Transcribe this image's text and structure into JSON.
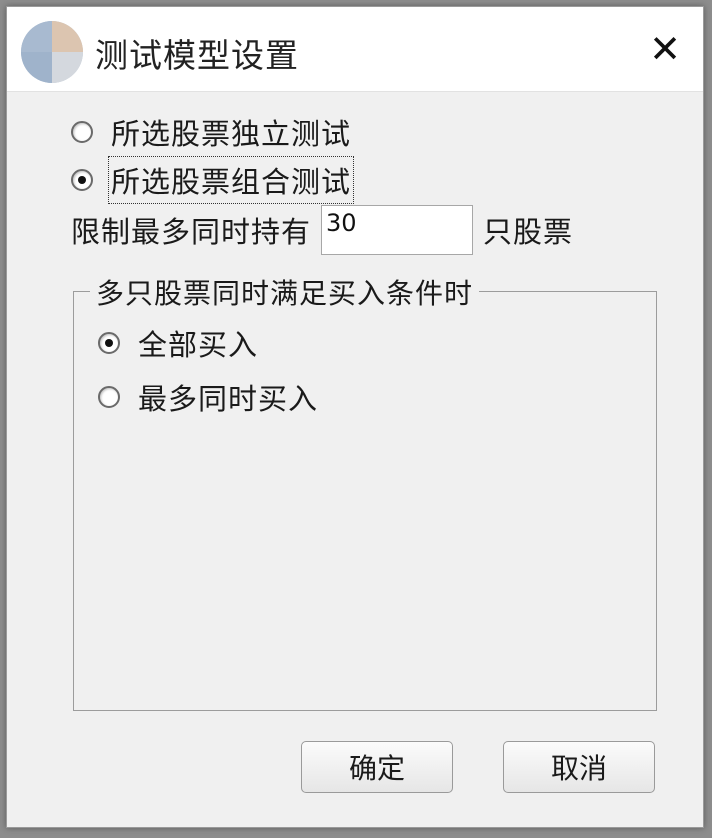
{
  "dialog": {
    "title": "测试模型设置",
    "close_icon": "close-icon"
  },
  "mode_options": [
    {
      "label": "所选股票独立测试",
      "checked": false
    },
    {
      "label": "所选股票组合测试",
      "checked": true
    }
  ],
  "limit": {
    "prefix": "限制最多同时持有",
    "value": "30",
    "suffix": "只股票"
  },
  "buy_group": {
    "title": "多只股票同时满足买入条件时",
    "options": [
      {
        "label": "全部买入",
        "checked": true
      },
      {
        "label": "最多同时买入",
        "checked": false
      }
    ]
  },
  "buttons": {
    "ok": "确定",
    "cancel": "取消"
  }
}
